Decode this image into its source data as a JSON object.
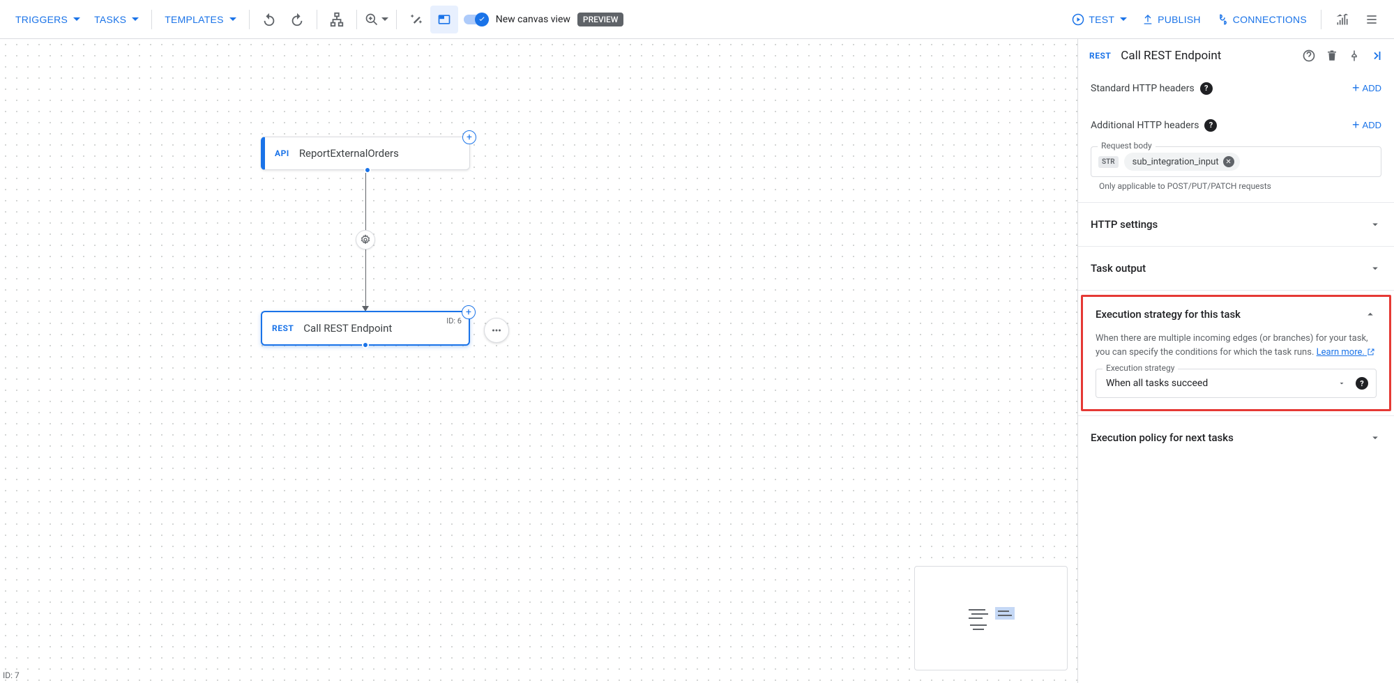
{
  "toolbar": {
    "triggers": "TRIGGERS",
    "tasks": "TASKS",
    "templates": "TEMPLATES",
    "canvas_view_label": "New canvas view",
    "preview_badge": "PREVIEW",
    "test": "TEST",
    "publish": "PUBLISH",
    "connections": "CONNECTIONS"
  },
  "canvas": {
    "trigger_node": {
      "badge": "API",
      "title": "ReportExternalOrders"
    },
    "task_node": {
      "badge": "REST",
      "title": "Call REST Endpoint",
      "id": "ID: 6"
    },
    "footer_id": "ID: 7"
  },
  "panel": {
    "header_badge": "REST",
    "title": "Call REST Endpoint",
    "std_headers_label": "Standard HTTP headers",
    "addl_headers_label": "Additional HTTP headers",
    "add_label": "ADD",
    "request_body": {
      "label": "Request body",
      "chip_type": "STR",
      "chip_value": "sub_integration_input",
      "help": "Only applicable to POST/PUT/PATCH requests"
    },
    "http_settings": "HTTP settings",
    "task_output": "Task output",
    "exec_strategy": {
      "title": "Execution strategy for this task",
      "desc_a": "When there are multiple incoming edges (or branches) for your task, you can specify the conditions for which the task runs. ",
      "learn_more": "Learn more.",
      "field_label": "Execution strategy",
      "value": "When all tasks succeed"
    },
    "exec_policy": "Execution policy for next tasks"
  }
}
